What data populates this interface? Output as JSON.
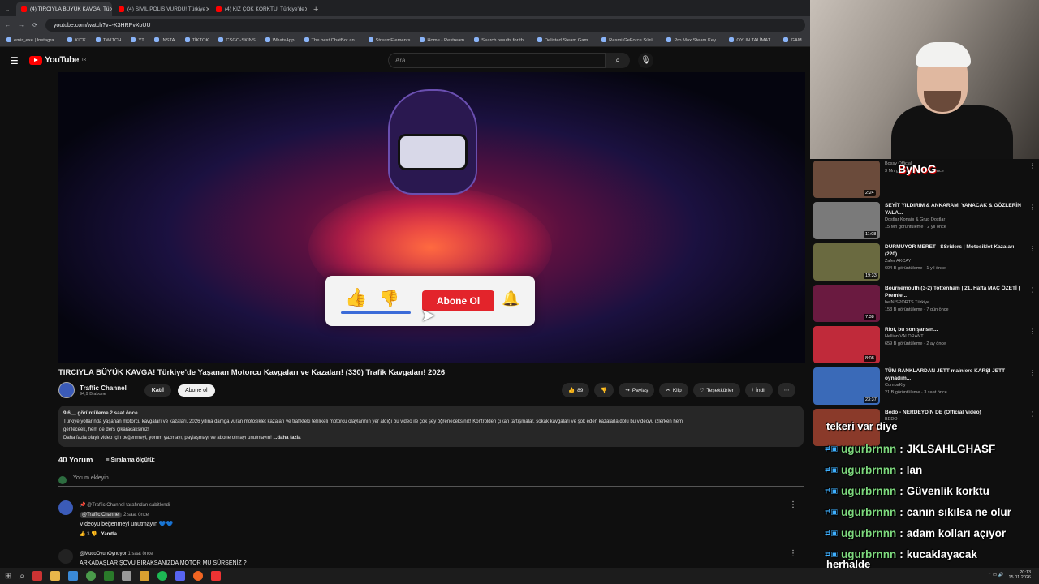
{
  "browser": {
    "tabs": [
      {
        "label": "(4) TIRCIYLA BÜYÜK KAVGA! Tü",
        "active": true
      },
      {
        "label": "(4) SİVİL POLİS VURDU! Türkiye",
        "active": false
      },
      {
        "label": "(4) KIZ ÇOK KORKTU: Türkiye'de",
        "active": false
      }
    ],
    "url": "youtube.com/watch?v=-K3HRPvXoUU",
    "bookmarks": [
      "emir_exe | Instagra...",
      "KICK",
      "TWITCH",
      "YT",
      "INSTA",
      "TİKTOK",
      "CSGO-SKINS",
      "WhatsApp",
      "The best ChatBot an...",
      "StreamElements",
      "Home - Restream",
      "Search results for th...",
      "Delisted Steam Gam...",
      "Resmi GeForce Sürü...",
      "Pro Max Steam Key...",
      "OYUN TALİMAT...",
      "GAM..."
    ]
  },
  "youtube": {
    "logo": "YouTube",
    "logo_region": "TR",
    "search_placeholder": "Ara"
  },
  "player_overlay": {
    "subscribe_label": "Abone Ol"
  },
  "video": {
    "title": "TIRCIYLA BÜYÜK KAVGA! Türkiye'de Yaşanan Motorcu Kavgaları ve Kazaları! (330) Trafik Kavgaları! 2026",
    "channel": "Traffic Channel",
    "subscribers": "94,9 B abone",
    "join_label": "Katıl",
    "subscribe_label": "Abone ol",
    "likes": "89",
    "share_label": "Paylaş",
    "clip_label": "Klip",
    "thanks_label": "Teşekkürler",
    "download_label": "İndir",
    "views": "9 6__ görüntüleme  2 saat önce",
    "desc_line1": "Türkiye yollarında yaşanan motorcu kavgaları ve kazaları, 2026 yılına damga vuran motosiklet kazaları ve trafikteki tehlikeli motorcu olaylarının yer aldığı bu video ile çok şey öğreneceksiniz! Kontrolden çıkan tartışmalar, sokak kavgaları ve şok eden kazalarla dolu bu videoyu izlerken hem",
    "desc_line2": "gerileceek, hem de ders çıkaracaksınız!",
    "desc_line3": "Daha fazla olaylı video için beğenmeyi, yorum yazmayı, paylaşmayı ve abone olmayı unutmayın!",
    "desc_more": "...daha fazla"
  },
  "comments": {
    "count": "40 Yorum",
    "sort_label": "Sıralama ölçütü:",
    "add_placeholder": "Yorum ekleyin...",
    "items": [
      {
        "pinned": "@Traffic.Channel tarafından sabitlendi",
        "author": "@Traffic.Channel",
        "time": "2 saat önce",
        "text": "Videoyu beğenmeyi unutmayın 💙💙",
        "likes": "3",
        "reply": "Yanıtla"
      },
      {
        "author": "@MucoOyunOynuyor",
        "time": "1 saat önce",
        "text": "ARKADAŞLAR ŞOVU BIRAKSANIZDA MOTOR MU SÜRSENİZ ?"
      }
    ]
  },
  "overlay_brand": "ByNoG",
  "sidebar": [
    {
      "title": "",
      "channel": "Bossy Official",
      "views": "3 Mn görüntüleme · 1 yıl önce",
      "duration": "2:24",
      "color": "#6b4b3b"
    },
    {
      "title": "SEYİT YILDIRIM & ANKARAMI YANACAK & GÖZLERİN YALA...",
      "channel": "Dostlar Konağı & Grup Dostlar",
      "views": "15 Mn görüntüleme · 2 yıl önce",
      "duration": "11:08",
      "color": "#7a7a7a"
    },
    {
      "title": "DURMUYOR MERET | SSriders | Motosiklet Kazaları (220)",
      "channel": "Zafer AKCAY",
      "views": "604 B görüntüleme · 1 yıl önce",
      "duration": "19:33",
      "color": "#6a6a40"
    },
    {
      "title": "Bournemouth (3-2) Tottenham | 21. Hafta MAÇ ÖZETİ | Premie...",
      "channel": "beIN SPORTS Türkiye",
      "views": "153 B görüntüleme · 7 gün önce",
      "duration": "7:38",
      "color": "#6a1a40"
    },
    {
      "title": "Riot, bu son şansın...",
      "channel": "Hellian VALORANT",
      "views": "659 B görüntüleme · 2 ay önce",
      "duration": "8:08",
      "color": "#c02a3a"
    },
    {
      "title": "TÜM RANKLARDAN JETT mainlere KARŞI JETT oynadım...",
      "channel": "CombaKty",
      "views": "21 B görüntüleme · 3 saat önce",
      "duration": "23:37",
      "color": "#3a6ab8"
    },
    {
      "title": "Bedo - NERDEYDİN DE (Official Video)",
      "channel": "BEDO",
      "views": "",
      "duration": "",
      "color": "#8a3a2a"
    }
  ],
  "chat": {
    "first_line": "tekeri var diye",
    "messages": [
      {
        "user": "ugurbrnnn",
        "text": "JKLSAHLGHASF"
      },
      {
        "user": "ugurbrnnn",
        "text": "lan"
      },
      {
        "user": "ugurbrnnn",
        "text": "Güvenlik korktu"
      },
      {
        "user": "ugurbrnnn",
        "text": "canın sıkılsa ne olur"
      },
      {
        "user": "ugurbrnnn",
        "text": "adam kolları açıyor"
      },
      {
        "user": "ugurbrnnn",
        "text": "kucaklayacak"
      }
    ],
    "last_line": "herhalde"
  },
  "taskbar": {
    "time": "20:13",
    "date": "15.01.2026"
  }
}
